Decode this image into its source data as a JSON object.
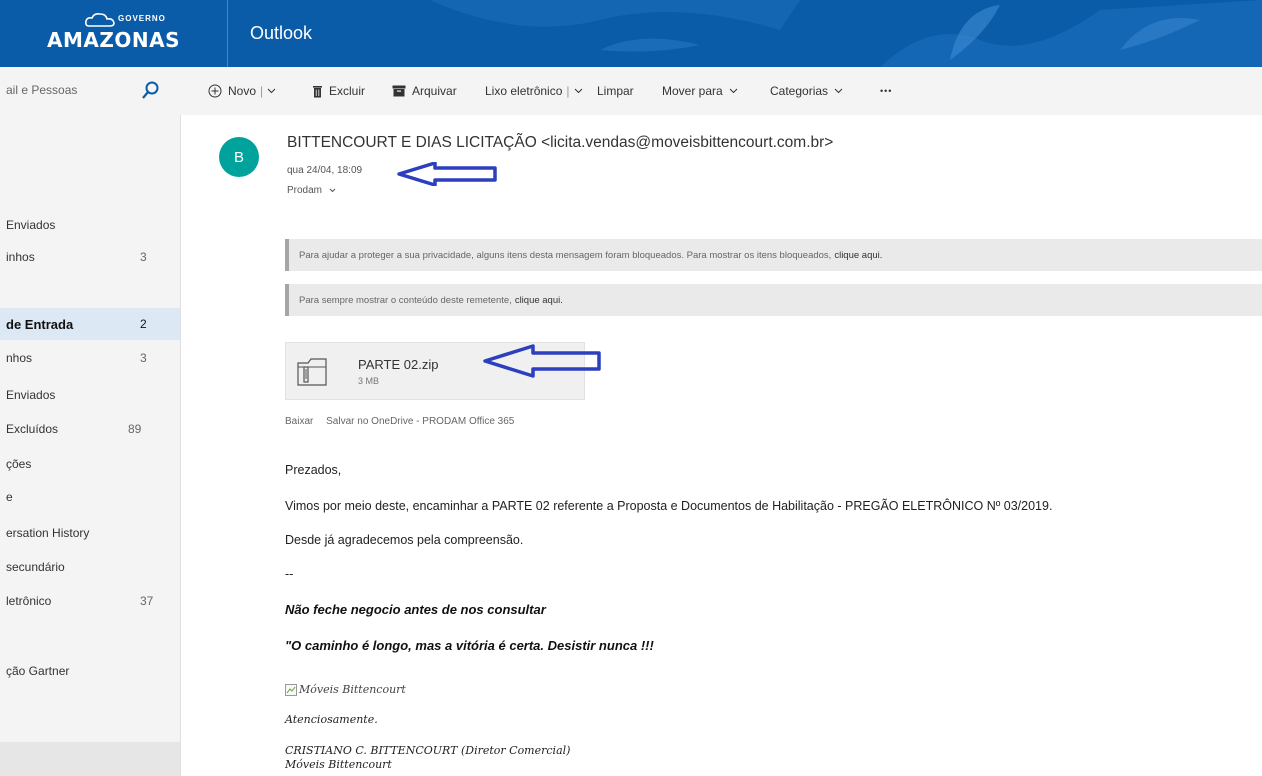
{
  "header": {
    "brand": "AMAZONAS",
    "brand_small": "GOVERNO",
    "app_title": "Outlook"
  },
  "search": {
    "placeholder": "ail e Pessoas"
  },
  "leftnav": {
    "items": [
      {
        "label": "Enviados",
        "count": ""
      },
      {
        "label": "inhos",
        "count": "3"
      },
      {
        "label": "de Entrada",
        "count": "2"
      },
      {
        "label": "nhos",
        "count": "3"
      },
      {
        "label": "Enviados",
        "count": ""
      },
      {
        "label": "Excluídos",
        "count": "89"
      },
      {
        "label": "ções",
        "count": ""
      },
      {
        "label": "e",
        "count": ""
      },
      {
        "label": "ersation History",
        "count": ""
      },
      {
        "label": "secundário",
        "count": ""
      },
      {
        "label": "letrônico",
        "count": "37"
      },
      {
        "label": "ção Gartner",
        "count": ""
      }
    ]
  },
  "toolbar": {
    "new": "Novo",
    "delete": "Excluir",
    "archive": "Arquivar",
    "junk": "Lixo eletrônico",
    "sweep": "Limpar",
    "move": "Mover para",
    "categories": "Categorias",
    "more": "•••"
  },
  "message": {
    "avatar_letter": "B",
    "sender": "BITTENCOURT E DIAS LICITAÇÃO <licita.vendas@moveisbittencourt.com.br>",
    "date": "qua 24/04, 18:09",
    "recipient": "Prodam",
    "notice1": "Para ajudar a proteger a sua privacidade, alguns itens desta mensagem foram bloqueados. Para mostrar os itens bloqueados,",
    "notice1_link": "clique aqui.",
    "notice2": "Para sempre mostrar o conteúdo deste remetente,",
    "notice2_link": "clique aqui.",
    "attachment": {
      "name": "PARTE 02.zip",
      "size": "3 MB"
    },
    "att_download": "Baixar",
    "att_save": "Salvar no OneDrive - PRODAM Office 365",
    "greeting": "Prezados,",
    "line1": "Vimos por meio deste, encaminhar a PARTE 02 referente a Proposta e Documentos de Habilitação - PREGÃO ELETRÔNICO Nº 03/2019.",
    "line2": "Desde já agradecemos pela compreensão.",
    "dash": "--",
    "quote1": "Não feche negocio antes de nos consultar",
    "quote2": "\"O caminho é longo, mas a vitória é certa. Desistir nunca !!!",
    "img_alt": "Móveis Bittencourt",
    "regards": "Atenciosamente.",
    "sig_name": "CRISTIANO C. BITTENCOURT (Diretor Comercial)",
    "sig_company": "Móveis Bittencourt"
  },
  "colors": {
    "header_bg": "#0a5ca8",
    "avatar_bg": "#00a39c",
    "arrow": "#2b3fbf",
    "selected_nav": "#dce8f4"
  }
}
